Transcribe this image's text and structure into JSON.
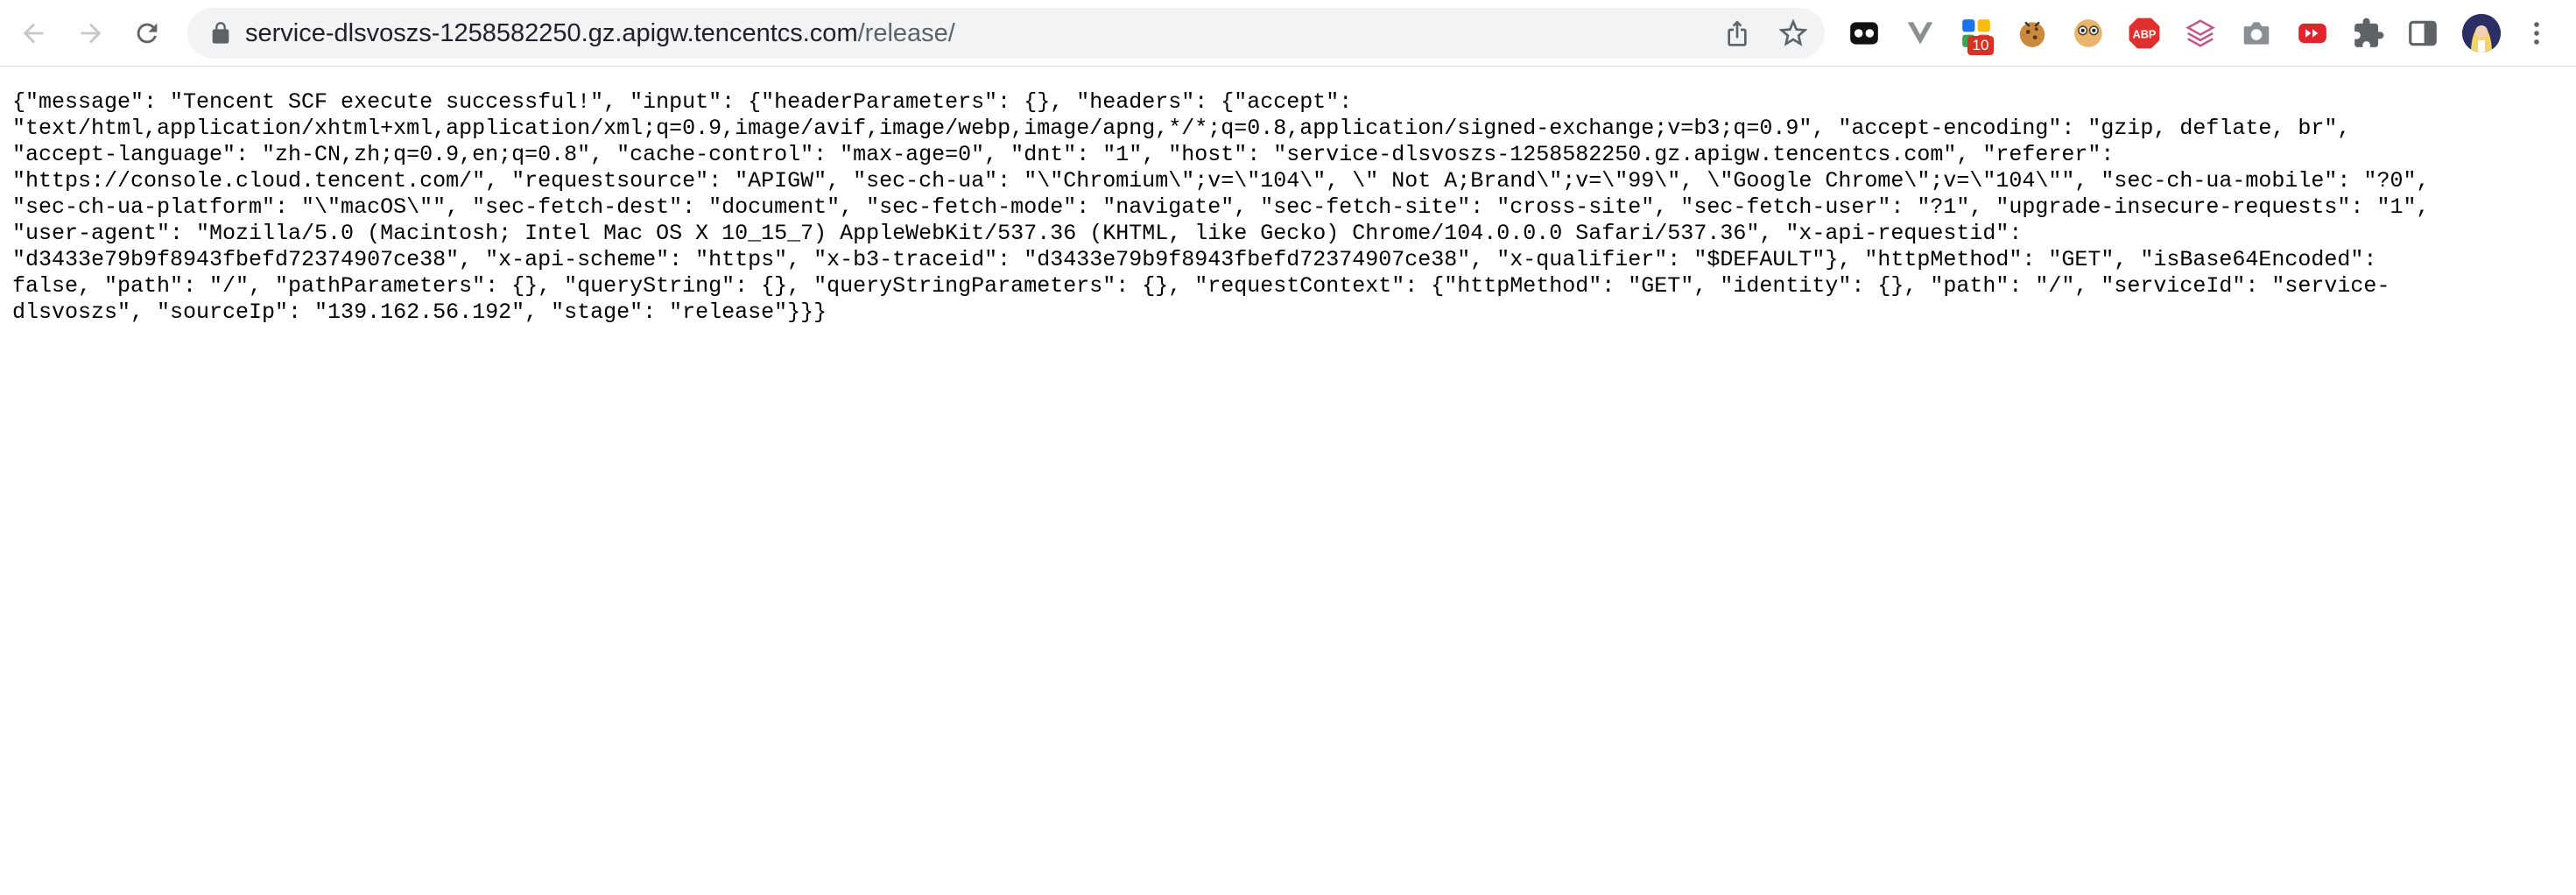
{
  "browser": {
    "url_host": "service-dlsvoszs-1258582250.gz.apigw.tencentcs.com",
    "url_path": "/release/",
    "extension_badge": "10",
    "toolbar_icons": [
      "back-icon",
      "forward-icon",
      "reload-icon",
      "lock-icon",
      "share-icon",
      "bookmark-star-icon",
      "extensions-puzzle-icon",
      "side-panel-icon",
      "avatar",
      "menu-icon"
    ]
  },
  "body_lines": [
    "{\"message\": \"Tencent SCF execute successful!\", \"input\": {\"headerParameters\": {}, \"headers\": {\"accept\":",
    "\"text/html,application/xhtml+xml,application/xml;q=0.9,image/avif,image/webp,image/apng,*/*;q=0.8,application/signed-exchange;v=b3;q=0.9\", \"accept-encoding\": \"gzip, deflate, br\",",
    "\"accept-language\": \"zh-CN,zh;q=0.9,en;q=0.8\", \"cache-control\": \"max-age=0\", \"dnt\": \"1\", \"host\": \"service-dlsvoszs-1258582250.gz.apigw.tencentcs.com\", \"referer\":",
    "\"https://console.cloud.tencent.com/\", \"requestsource\": \"APIGW\", \"sec-ch-ua\": \"\\\"Chromium\\\";v=\\\"104\\\", \\\" Not A;Brand\\\";v=\\\"99\\\", \\\"Google Chrome\\\";v=\\\"104\\\"\", \"sec-ch-ua-mobile\": \"?0\",",
    "\"sec-ch-ua-platform\": \"\\\"macOS\\\"\", \"sec-fetch-dest\": \"document\", \"sec-fetch-mode\": \"navigate\", \"sec-fetch-site\": \"cross-site\", \"sec-fetch-user\": \"?1\", \"upgrade-insecure-requests\": \"1\",",
    "\"user-agent\": \"Mozilla/5.0 (Macintosh; Intel Mac OS X 10_15_7) AppleWebKit/537.36 (KHTML, like Gecko) Chrome/104.0.0.0 Safari/537.36\", \"x-api-requestid\":",
    "\"d3433e79b9f8943fbefd72374907ce38\", \"x-api-scheme\": \"https\", \"x-b3-traceid\": \"d3433e79b9f8943fbefd72374907ce38\", \"x-qualifier\": \"$DEFAULT\"}, \"httpMethod\": \"GET\", \"isBase64Encoded\":",
    "false, \"path\": \"/\", \"pathParameters\": {}, \"queryString\": {}, \"queryStringParameters\": {}, \"requestContext\": {\"httpMethod\": \"GET\", \"identity\": {}, \"path\": \"/\", \"serviceId\": \"service-",
    "dlsvoszs\", \"sourceIp\": \"139.162.56.192\", \"stage\": \"release\"}}}"
  ]
}
